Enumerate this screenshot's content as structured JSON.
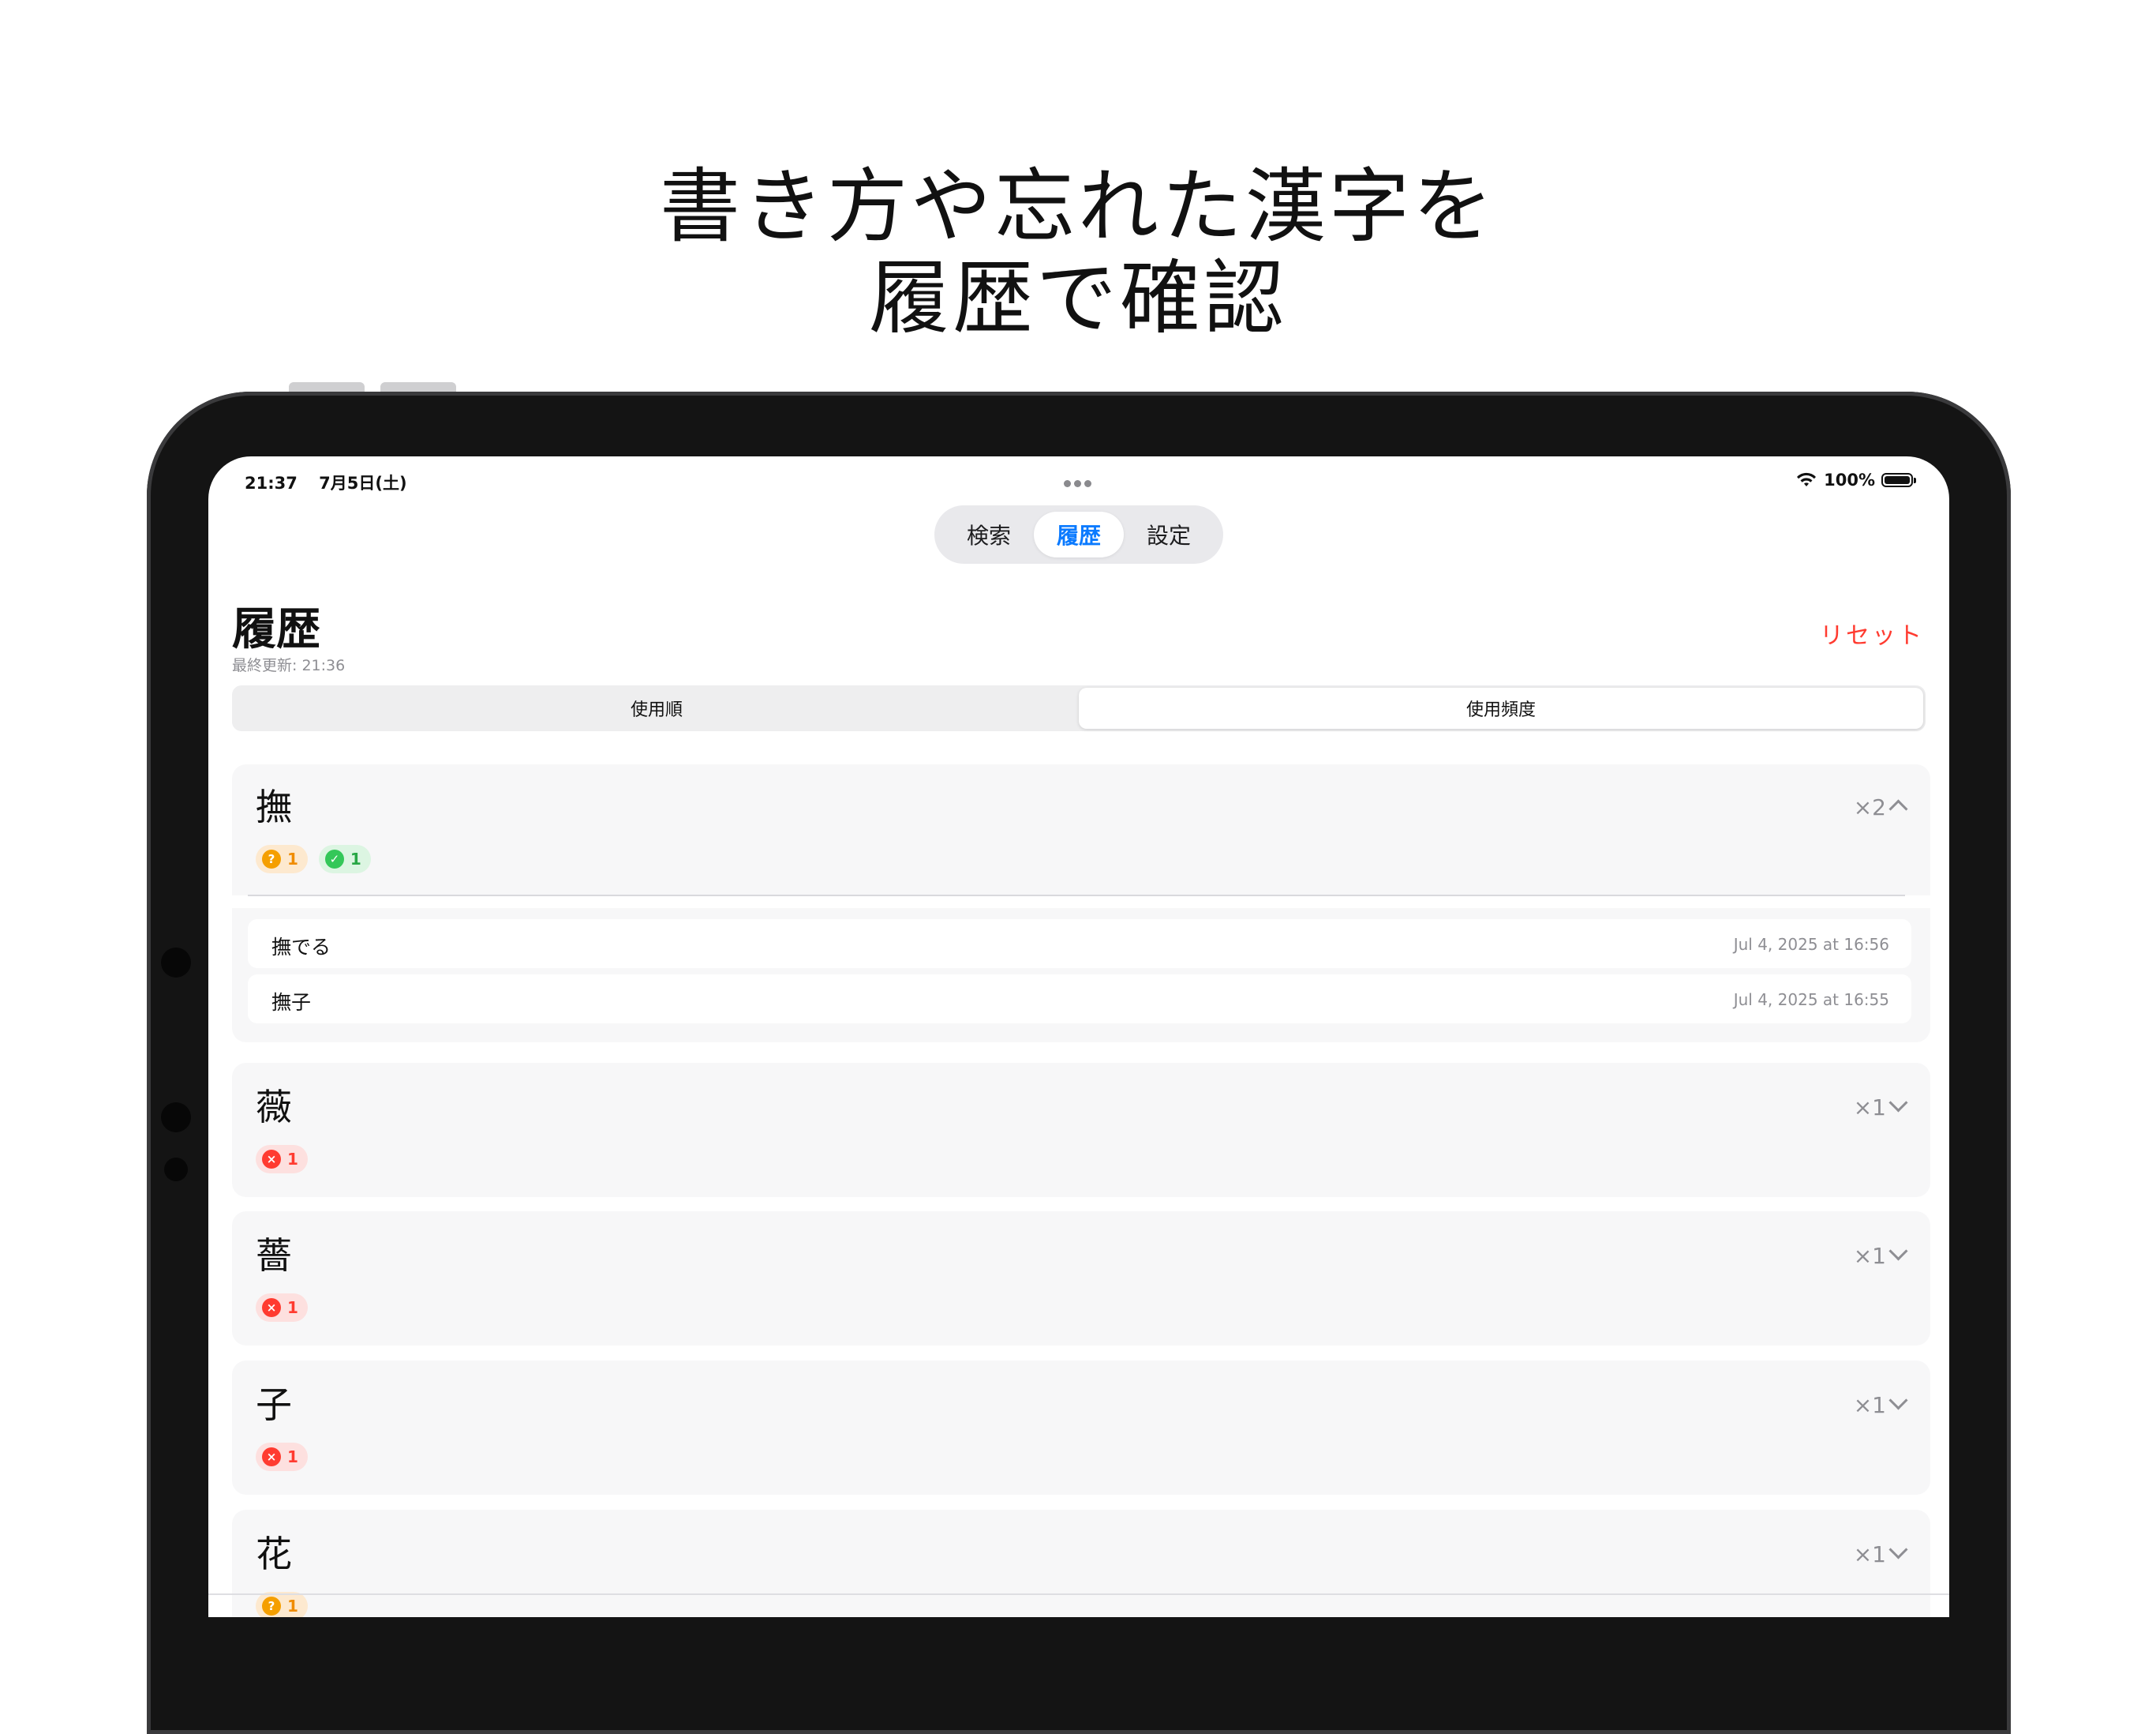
{
  "headline": {
    "line1": "書き方や忘れた漢字を",
    "line2": "履歴で確認"
  },
  "status_bar": {
    "time": "21:37",
    "date": "7月5日(土)",
    "battery": "100%"
  },
  "tabs": [
    {
      "label": "検索",
      "active": false
    },
    {
      "label": "履歴",
      "active": true
    },
    {
      "label": "設定",
      "active": false
    }
  ],
  "page": {
    "title": "履歴",
    "last_updated": "最終更新: 21:36",
    "reset_label": "リセット"
  },
  "segment": {
    "options": [
      "使用順",
      "使用頻度"
    ],
    "selected": "使用頻度"
  },
  "history": [
    {
      "kanji": "撫",
      "count": "×2",
      "expanded": true,
      "badges": [
        {
          "type": "question",
          "color": "orange",
          "icon": "?",
          "value": "1"
        },
        {
          "type": "check",
          "color": "green",
          "icon": "✓",
          "value": "1"
        }
      ],
      "words": [
        {
          "text": "撫でる",
          "date": "Jul 4, 2025 at 16:56"
        },
        {
          "text": "撫子",
          "date": "Jul 4, 2025 at 16:55"
        }
      ]
    },
    {
      "kanji": "薇",
      "count": "×1",
      "expanded": false,
      "badges": [
        {
          "type": "cross",
          "color": "red",
          "icon": "×",
          "value": "1"
        }
      ]
    },
    {
      "kanji": "薔",
      "count": "×1",
      "expanded": false,
      "badges": [
        {
          "type": "cross",
          "color": "red",
          "icon": "×",
          "value": "1"
        }
      ]
    },
    {
      "kanji": "子",
      "count": "×1",
      "expanded": false,
      "badges": [
        {
          "type": "cross",
          "color": "red",
          "icon": "×",
          "value": "1"
        }
      ]
    },
    {
      "kanji": "花",
      "count": "×1",
      "expanded": false,
      "badges": [
        {
          "type": "question",
          "color": "orange",
          "icon": "?",
          "value": "1"
        }
      ]
    }
  ]
}
